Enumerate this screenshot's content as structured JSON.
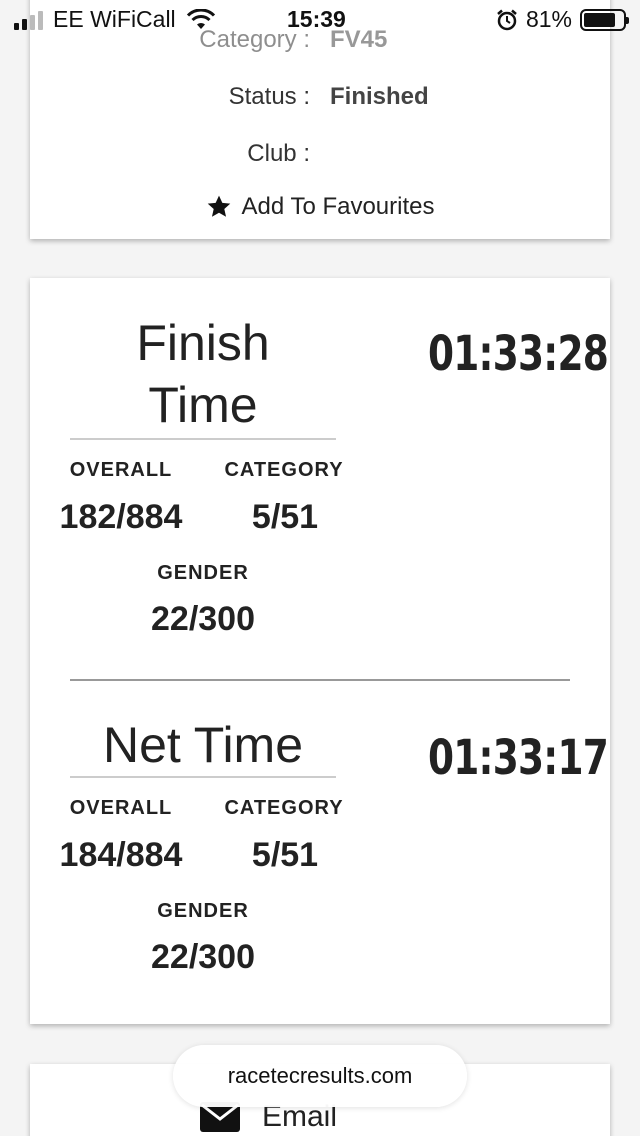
{
  "status_bar": {
    "carrier": "EE WiFiCall",
    "time": "15:39",
    "battery_percent": "81%",
    "battery_level": 0.81,
    "icons": [
      "signal-icon",
      "wifi-icon",
      "alarm-icon",
      "battery-icon"
    ]
  },
  "info_card": {
    "category_label": "Category :",
    "category_value": "FV45",
    "status_label": "Status :",
    "status_value": "Finished",
    "club_label": "Club :",
    "club_value": "",
    "favourites_label": "Add To Favourites",
    "favourites_icon": "star-icon"
  },
  "results": {
    "finish": {
      "title_line1": "Finish",
      "title_line2": "Time",
      "time": "01:33:28",
      "overall_label": "OVERALL",
      "overall_value": "182/884",
      "category_label": "CATEGORY",
      "category_value": "5/51",
      "gender_label": "GENDER",
      "gender_value": "22/300"
    },
    "net": {
      "title": "Net Time",
      "time": "01:33:17",
      "overall_label": "OVERALL",
      "overall_value": "184/884",
      "category_label": "CATEGORY",
      "category_value": "5/51",
      "gender_label": "GENDER",
      "gender_value": "22/300"
    }
  },
  "share": {
    "email_label": "Email",
    "email_icon": "mail-icon"
  },
  "browser": {
    "url": "racetecresults.com"
  }
}
